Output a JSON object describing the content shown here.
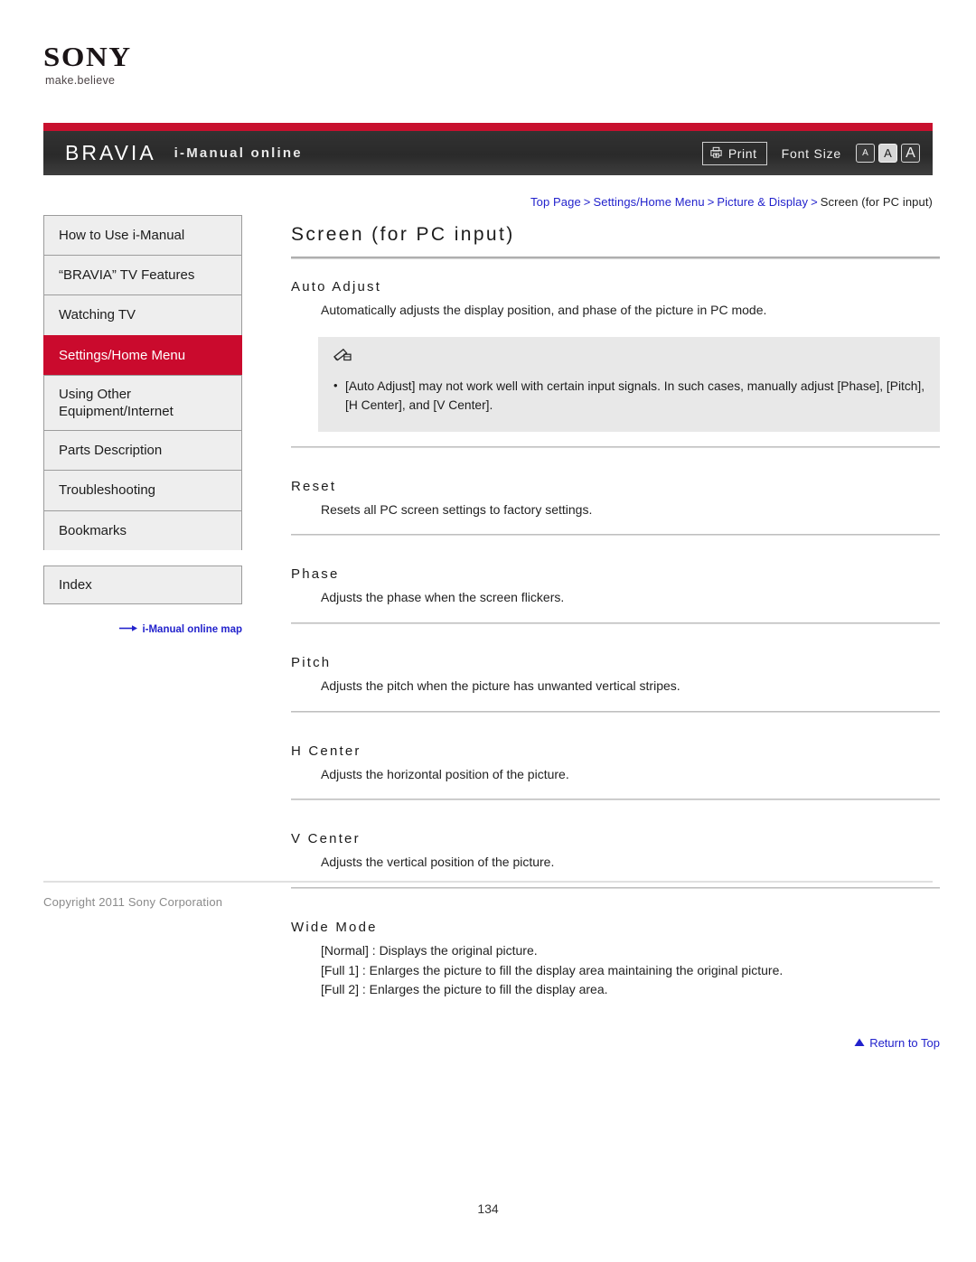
{
  "logo": {
    "wordmark": "SONY",
    "tagline": "make.believe"
  },
  "header": {
    "brand": "BRAVIA",
    "subtitle": "i-Manual online",
    "print_label": "Print",
    "print_icon": "printer-icon",
    "font_size_label": "Font Size",
    "font_size_options": [
      {
        "label": "A",
        "size": "small",
        "selected": false
      },
      {
        "label": "A",
        "size": "medium",
        "selected": true
      },
      {
        "label": "A",
        "size": "large",
        "selected": false
      }
    ],
    "accent_red": "#c8102e",
    "bar_dark": "#2a2a2a"
  },
  "breadcrumb": {
    "separator": ">",
    "items": [
      {
        "label": "Top Page",
        "link": true
      },
      {
        "label": "Settings/Home Menu",
        "link": true
      },
      {
        "label": "Picture & Display",
        "link": true
      },
      {
        "label": "Screen (for PC input)",
        "link": false
      }
    ]
  },
  "sidebar": {
    "items": [
      {
        "label": "How to Use i-Manual",
        "active": false
      },
      {
        "label": "“BRAVIA” TV Features",
        "active": false
      },
      {
        "label": "Watching TV",
        "active": false
      },
      {
        "label": "Settings/Home Menu",
        "active": true
      },
      {
        "label": "Using Other Equipment/Internet",
        "active": false,
        "two_line": true
      },
      {
        "label": "Parts Description",
        "active": false
      },
      {
        "label": "Troubleshooting",
        "active": false
      },
      {
        "label": "Bookmarks",
        "active": false
      }
    ],
    "index_label": "Index",
    "map_link_label": "i-Manual online map",
    "map_link_icon": "arrow-right-icon",
    "active_color": "#ca0a2d"
  },
  "main": {
    "title": "Screen (for PC input)",
    "sections": [
      {
        "heading": "Auto Adjust",
        "body": [
          "Automatically adjusts the display position, and phase of the picture in PC mode."
        ],
        "note": {
          "icon": "note-pencil-icon",
          "bullets": [
            "[Auto Adjust] may not work well with certain input signals. In such cases, manually adjust [Phase], [Pitch], [H Center], and [V Center]."
          ]
        },
        "rule_after": true
      },
      {
        "heading": "Reset",
        "body": [
          "Resets all PC screen settings to factory settings."
        ],
        "rule_after": true
      },
      {
        "heading": "Phase",
        "body": [
          "Adjusts the phase when the screen flickers."
        ],
        "rule_after": true
      },
      {
        "heading": "Pitch",
        "body": [
          "Adjusts the pitch when the picture has unwanted vertical stripes."
        ],
        "rule_after": true
      },
      {
        "heading": "H Center",
        "body": [
          "Adjusts the horizontal position of the picture."
        ],
        "rule_after": true
      },
      {
        "heading": "V Center",
        "body": [
          "Adjusts the vertical position of the picture."
        ],
        "rule_after": true
      },
      {
        "heading": "Wide Mode",
        "body": [
          "[Normal] : Displays the original picture.",
          "[Full 1] : Enlarges the picture to fill the display area maintaining the original picture.",
          "[Full 2] : Enlarges the picture to fill the display area."
        ],
        "rule_after": false
      }
    ],
    "return_to_top": "Return to Top",
    "return_to_top_icon": "triangle-up-icon"
  },
  "footer": {
    "copyright": "Copyright 2011 Sony Corporation",
    "page_number": "134"
  }
}
